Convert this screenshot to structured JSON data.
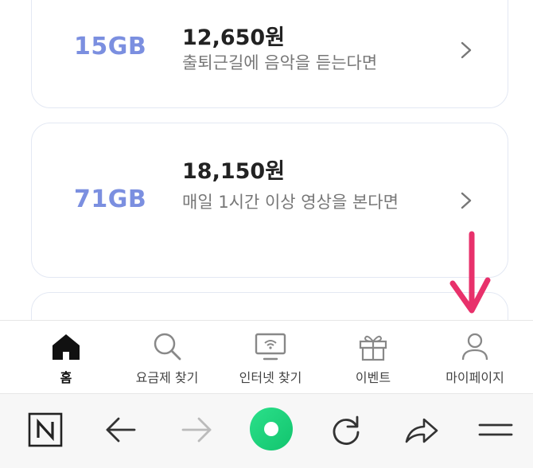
{
  "plans": [
    {
      "data_amount": "15GB",
      "price": "12,650원",
      "description": "출퇴근길에 음악을 듣는다면"
    },
    {
      "data_amount": "71GB",
      "price": "18,150원",
      "description": "매일 1시간 이상 영상을 본다면"
    }
  ],
  "tabbar": {
    "items": [
      {
        "label": "홈",
        "icon": "home-icon",
        "active": true
      },
      {
        "label": "요금제 찾기",
        "icon": "search-icon",
        "active": false
      },
      {
        "label": "인터넷 찾기",
        "icon": "monitor-wifi-icon",
        "active": false
      },
      {
        "label": "이벤트",
        "icon": "gift-icon",
        "active": false
      },
      {
        "label": "마이페이지",
        "icon": "user-icon",
        "active": false
      }
    ]
  },
  "browser_toolbar": {
    "icons": [
      "naver-n-icon",
      "back-arrow-icon",
      "forward-arrow-icon",
      "green-home-circle-icon",
      "refresh-icon",
      "share-icon",
      "menu-icon"
    ]
  },
  "colors": {
    "accent_gb": "#7b8fe0",
    "annotation_arrow": "#e8316b",
    "green_circle": "#1ed47a",
    "card_border": "#e3e8f3"
  }
}
